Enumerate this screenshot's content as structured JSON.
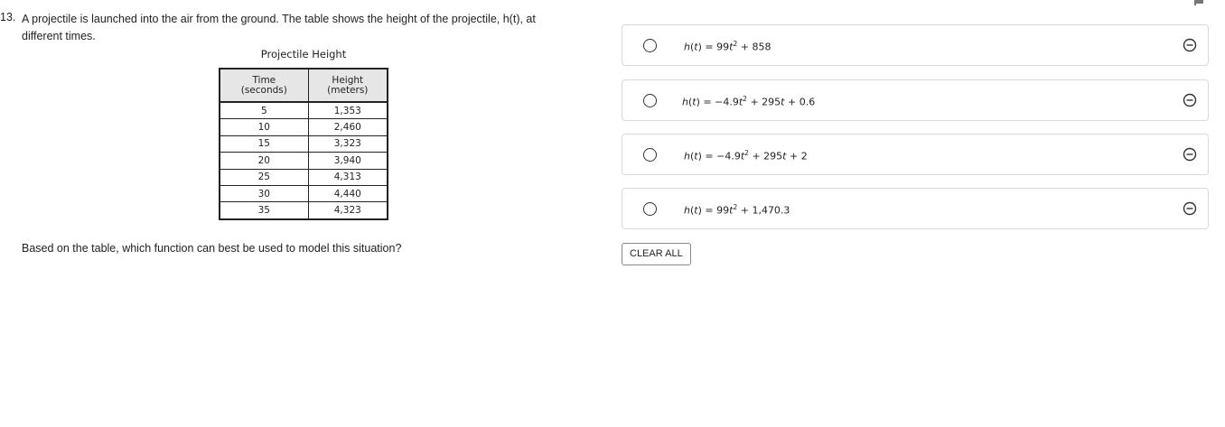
{
  "question": {
    "number": "13.",
    "text": "A projectile is launched into the air from the ground. The table shows the height of the projectile, h(t), at different times.",
    "prompt": "Based on the table, which function can best be used to model this situation?"
  },
  "table": {
    "title": "Projectile Height",
    "headers": [
      {
        "line1": "Time",
        "line2": "(seconds)"
      },
      {
        "line1": "Height",
        "line2": "(meters)"
      }
    ],
    "rows": [
      [
        "5",
        "1,353"
      ],
      [
        "10",
        "2,460"
      ],
      [
        "15",
        "3,323"
      ],
      [
        "20",
        "3,940"
      ],
      [
        "25",
        "4,313"
      ],
      [
        "30",
        "4,440"
      ],
      [
        "35",
        "4,323"
      ]
    ]
  },
  "choices": [
    {
      "fn": "h",
      "var": "t",
      "eq": " = ",
      "parts": [
        {
          "text": "99"
        },
        {
          "var": "t"
        },
        {
          "sup": "2"
        },
        {
          "text": " + 858"
        }
      ]
    },
    {
      "fn": "h",
      "var": "t",
      "eq": " = ",
      "parts": [
        {
          "text": "−4.9"
        },
        {
          "var": "t"
        },
        {
          "sup": "2"
        },
        {
          "text": " + 295"
        },
        {
          "var": "t"
        },
        {
          "text": " + 0.6"
        }
      ]
    },
    {
      "fn": "h",
      "var": "t",
      "eq": " = ",
      "parts": [
        {
          "text": "−4.9"
        },
        {
          "var": "t"
        },
        {
          "sup": "2"
        },
        {
          "text": " + 295"
        },
        {
          "var": "t"
        },
        {
          "text": " + 2"
        }
      ]
    },
    {
      "fn": "h",
      "var": "t",
      "eq": " = ",
      "parts": [
        {
          "text": "99"
        },
        {
          "var": "t"
        },
        {
          "sup": "2"
        },
        {
          "text": " + 1,470.3"
        }
      ]
    }
  ],
  "clear_all_label": "CLEAR ALL",
  "icons": {
    "flag": "flag-icon",
    "radio": "radio-circle",
    "eliminate": "circle-minus-icon"
  }
}
